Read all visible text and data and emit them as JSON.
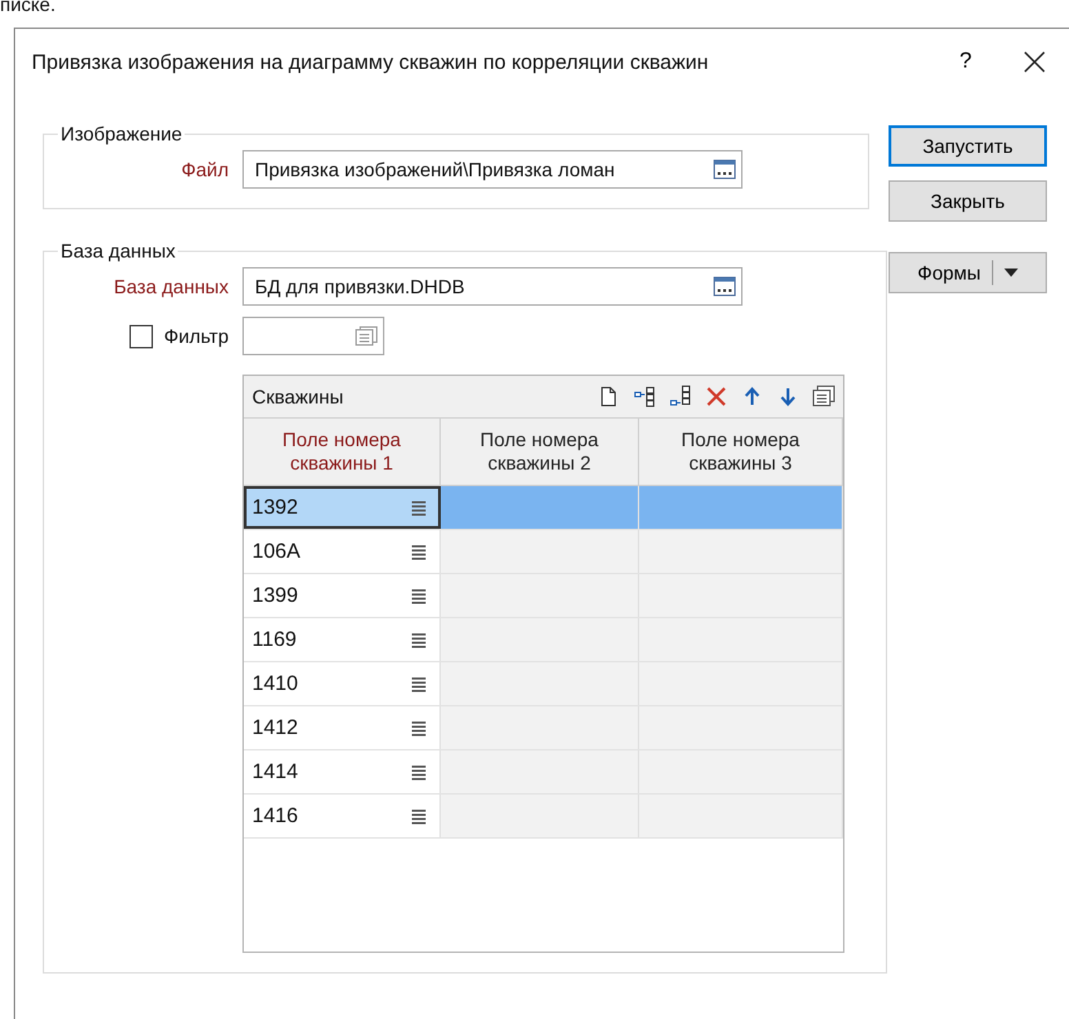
{
  "page_fragment": "писке.",
  "window": {
    "title": "Привязка изображения на диаграмму скважин по корреляции скважин",
    "help": "?"
  },
  "image_group": {
    "title": "Изображение",
    "file": {
      "label": "Файл",
      "value": "Привязка изображений\\Привязка ломан"
    }
  },
  "database_group": {
    "title": "База данных",
    "database": {
      "label": "База данных",
      "value": "БД для привязки.DHDB"
    },
    "filter": {
      "label": "Фильтр",
      "checked": false
    },
    "grid": {
      "title": "Скважины",
      "columns": [
        {
          "label": "Поле номера скважины 1",
          "required": true
        },
        {
          "label": "Поле номера скважины 2",
          "required": false
        },
        {
          "label": "Поле номера скважины 3",
          "required": false
        }
      ],
      "rows": [
        {
          "value": "1392",
          "selected": true
        },
        {
          "value": "106A",
          "selected": false
        },
        {
          "value": "1399",
          "selected": false
        },
        {
          "value": "1169",
          "selected": false
        },
        {
          "value": "1410",
          "selected": false
        },
        {
          "value": "1412",
          "selected": false
        },
        {
          "value": "1414",
          "selected": false
        },
        {
          "value": "1416",
          "selected": false
        }
      ]
    }
  },
  "buttons": [
    {
      "label": "Запустить",
      "kind": "plain",
      "default": true
    },
    {
      "label": "Закрыть",
      "kind": "plain",
      "default": false
    },
    {
      "label": "Формы",
      "kind": "split",
      "default": false
    }
  ]
}
